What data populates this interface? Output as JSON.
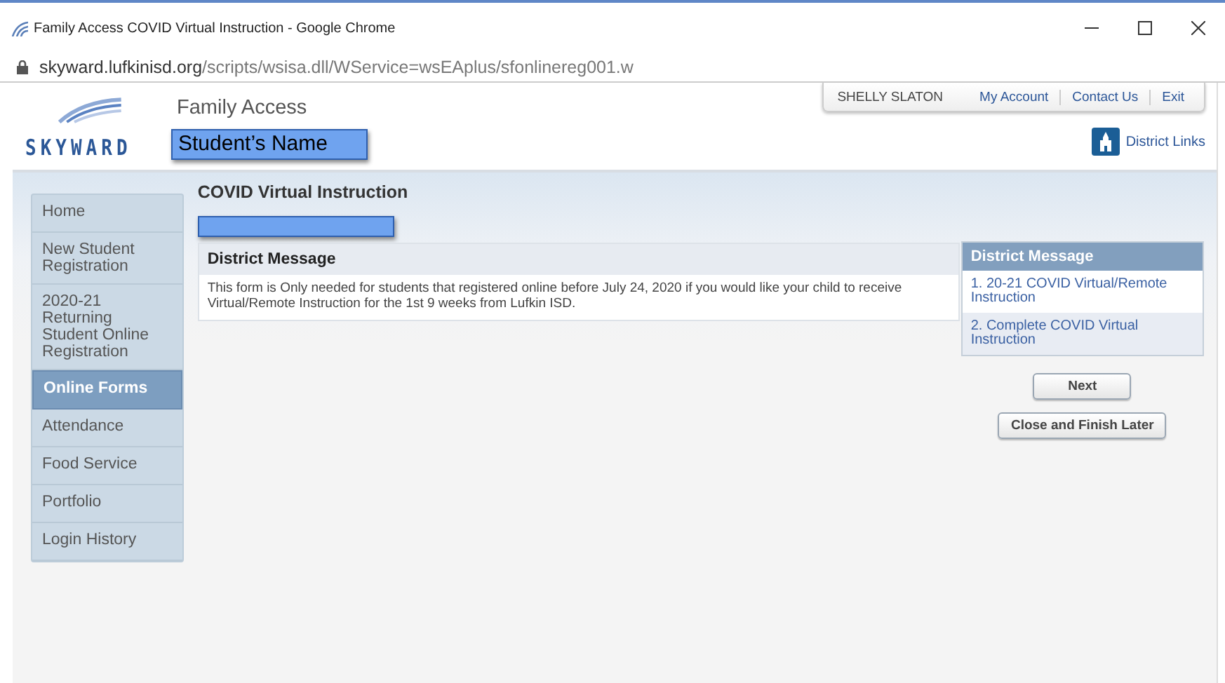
{
  "window": {
    "title": "Family Access COVID Virtual Instruction - Google Chrome",
    "url_host": "skyward.lufkinisd.org",
    "url_path": "/scripts/wsisa.dll/WService=wsEAplus/sfonlinereg001.w"
  },
  "header": {
    "logo_text": "SKYWARD",
    "app_name": "Family Access",
    "student_label": "Student’s Name",
    "user": "SHELLY SLATON",
    "links": [
      "My Account",
      "Contact Us",
      "Exit"
    ],
    "district_links": "District Links"
  },
  "sidebar": {
    "items": [
      {
        "label": "Home",
        "selected": false
      },
      {
        "label": "New Student Registration",
        "selected": false
      },
      {
        "label": "2020-21 Returning Student Online Registration",
        "selected": false
      },
      {
        "label": "Online Forms",
        "selected": true
      },
      {
        "label": "Attendance",
        "selected": false
      },
      {
        "label": "Food Service",
        "selected": false
      },
      {
        "label": "Portfolio",
        "selected": false
      },
      {
        "label": "Login History",
        "selected": false
      }
    ]
  },
  "page": {
    "title": "COVID Virtual Instruction",
    "message_title": "District Message",
    "message": "This form is Only needed for students that registered online before July 24, 2020 if you would like your child to receive Virtual/Remote Instruction for the 1st 9 weeks from Lufkin ISD."
  },
  "steps": {
    "title": "District Message",
    "items": [
      {
        "label": "1. 20-21 COVID Virtual/Remote Instruction",
        "selected": true
      },
      {
        "label": "2. Complete COVID Virtual Instruction",
        "selected": false
      }
    ]
  },
  "buttons": [
    "Next",
    "Close and Finish Later"
  ]
}
